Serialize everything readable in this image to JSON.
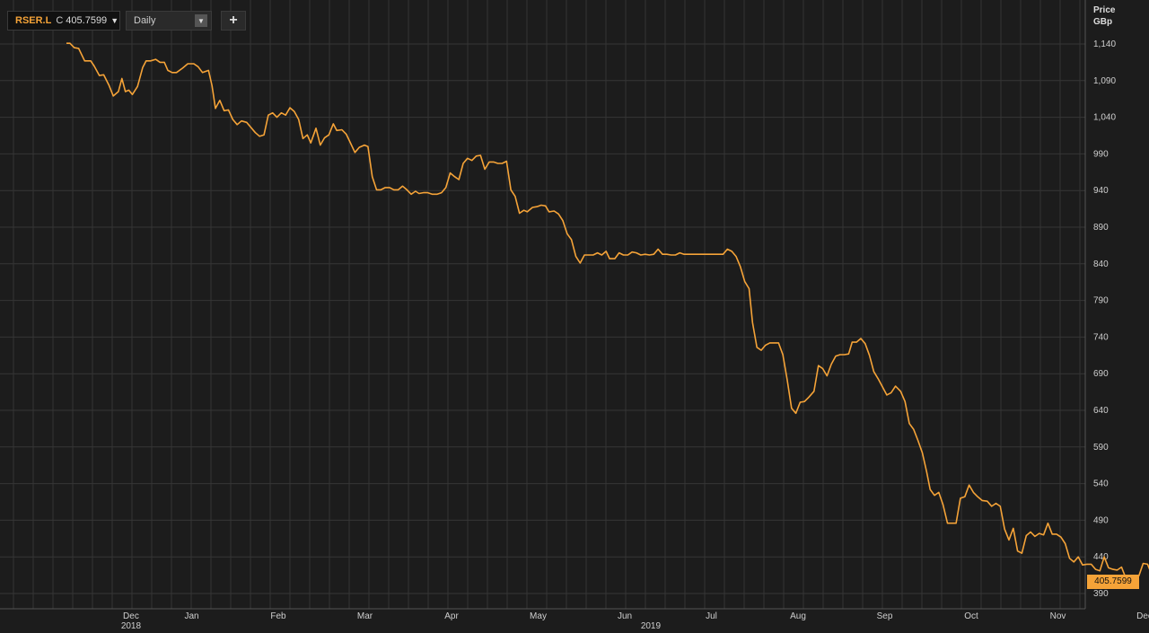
{
  "toolbar": {
    "symbol": "RSER.L",
    "close_tag": "C",
    "close_value": "405.7599",
    "interval": "Daily",
    "add_label": "+"
  },
  "axis": {
    "price_label": "Price",
    "currency_label": "GBp"
  },
  "last_price_label": "405.7599",
  "colors": {
    "line": "#f5a338",
    "background": "#1c1c1c",
    "grid": "#3a3a3a"
  },
  "chart_data": {
    "type": "line",
    "title": "",
    "xlabel": "",
    "ylabel": "Price GBp",
    "ylim": [
      380,
      1150
    ],
    "y_ticks": [
      390,
      440,
      490,
      540,
      590,
      640,
      690,
      740,
      790,
      840,
      890,
      940,
      990,
      1040,
      1090,
      1140
    ],
    "x_months": [
      {
        "label": "Dec",
        "year": "2018",
        "x": 0.3
      },
      {
        "label": "Jan",
        "x": 1.0
      },
      {
        "label": "Feb",
        "x": 2.0
      },
      {
        "label": "Mar",
        "x": 3.0
      },
      {
        "label": "Apr",
        "x": 4.0
      },
      {
        "label": "May",
        "x": 5.0
      },
      {
        "label": "Jun",
        "x": 6.0
      },
      {
        "label": "Jul",
        "x": 7.0
      },
      {
        "label": "Aug",
        "x": 8.0
      },
      {
        "label": "Sep",
        "x": 9.0
      },
      {
        "label": "Oct",
        "x": 10.0
      },
      {
        "label": "Nov",
        "x": 11.0
      },
      {
        "label": "Dec",
        "x": 12.0
      }
    ],
    "year_label": {
      "label": "2019",
      "x": 6.3
    },
    "x_range": [
      -0.3,
      11.8
    ],
    "series": [
      {
        "name": "RSER.L",
        "points": [
          [
            -0.3,
            1141
          ],
          [
            -0.26,
            1141
          ],
          [
            -0.21,
            1135
          ],
          [
            -0.16,
            1134
          ],
          [
            -0.09,
            1117
          ],
          [
            -0.02,
            1117
          ],
          [
            0.02,
            1110
          ],
          [
            0.08,
            1097
          ],
          [
            0.13,
            1098
          ],
          [
            0.19,
            1084
          ],
          [
            0.24,
            1069
          ],
          [
            0.3,
            1075
          ],
          [
            0.34,
            1093
          ],
          [
            0.38,
            1075
          ],
          [
            0.42,
            1077
          ],
          [
            0.46,
            1071
          ],
          [
            0.52,
            1082
          ],
          [
            0.58,
            1108
          ],
          [
            0.62,
            1117
          ],
          [
            0.67,
            1117
          ],
          [
            0.73,
            1119
          ],
          [
            0.78,
            1115
          ],
          [
            0.83,
            1115
          ],
          [
            0.87,
            1104
          ],
          [
            0.92,
            1101
          ],
          [
            0.97,
            1101
          ],
          [
            1.04,
            1107
          ],
          [
            1.1,
            1113
          ],
          [
            1.17,
            1113
          ],
          [
            1.22,
            1109
          ],
          [
            1.27,
            1101
          ],
          [
            1.34,
            1104
          ],
          [
            1.38,
            1083
          ],
          [
            1.42,
            1052
          ],
          [
            1.47,
            1063
          ],
          [
            1.52,
            1049
          ],
          [
            1.57,
            1050
          ],
          [
            1.62,
            1037
          ],
          [
            1.67,
            1030
          ],
          [
            1.72,
            1035
          ],
          [
            1.78,
            1033
          ],
          [
            1.83,
            1026
          ],
          [
            1.88,
            1019
          ],
          [
            1.93,
            1014
          ],
          [
            1.98,
            1016
          ],
          [
            2.03,
            1043
          ],
          [
            2.08,
            1046
          ],
          [
            2.13,
            1040
          ],
          [
            2.18,
            1046
          ],
          [
            2.23,
            1043
          ],
          [
            2.28,
            1053
          ],
          [
            2.33,
            1048
          ],
          [
            2.38,
            1037
          ],
          [
            2.43,
            1011
          ],
          [
            2.48,
            1016
          ],
          [
            2.52,
            1005
          ],
          [
            2.58,
            1025
          ],
          [
            2.63,
            1002
          ],
          [
            2.68,
            1012
          ],
          [
            2.73,
            1016
          ],
          [
            2.78,
            1031
          ],
          [
            2.82,
            1022
          ],
          [
            2.88,
            1023
          ],
          [
            2.93,
            1017
          ],
          [
            2.97,
            1007
          ],
          [
            3.03,
            992
          ],
          [
            3.08,
            999
          ],
          [
            3.14,
            1002
          ],
          [
            3.18,
            1000
          ],
          [
            3.23,
            959
          ],
          [
            3.28,
            941
          ],
          [
            3.33,
            941
          ],
          [
            3.38,
            944
          ],
          [
            3.43,
            944
          ],
          [
            3.48,
            941
          ],
          [
            3.53,
            941
          ],
          [
            3.58,
            946
          ],
          [
            3.63,
            941
          ],
          [
            3.68,
            935
          ],
          [
            3.73,
            939
          ],
          [
            3.77,
            936
          ],
          [
            3.82,
            937
          ],
          [
            3.87,
            937
          ],
          [
            3.92,
            935
          ],
          [
            3.98,
            935
          ],
          [
            4.03,
            937
          ],
          [
            4.08,
            944
          ],
          [
            4.13,
            964
          ],
          [
            4.18,
            959
          ],
          [
            4.23,
            955
          ],
          [
            4.28,
            977
          ],
          [
            4.33,
            984
          ],
          [
            4.38,
            981
          ],
          [
            4.43,
            987
          ],
          [
            4.48,
            988
          ],
          [
            4.53,
            969
          ],
          [
            4.58,
            979
          ],
          [
            4.63,
            979
          ],
          [
            4.68,
            977
          ],
          [
            4.73,
            977
          ],
          [
            4.78,
            980
          ],
          [
            4.83,
            941
          ],
          [
            4.88,
            932
          ],
          [
            4.93,
            909
          ],
          [
            4.98,
            913
          ],
          [
            5.02,
            911
          ],
          [
            5.08,
            917
          ],
          [
            5.13,
            918
          ],
          [
            5.18,
            920
          ],
          [
            5.23,
            919
          ],
          [
            5.27,
            911
          ],
          [
            5.33,
            912
          ],
          [
            5.38,
            908
          ],
          [
            5.43,
            899
          ],
          [
            5.48,
            881
          ],
          [
            5.53,
            873
          ],
          [
            5.58,
            850
          ],
          [
            5.63,
            841
          ],
          [
            5.68,
            852
          ],
          [
            5.73,
            852
          ],
          [
            5.78,
            852
          ],
          [
            5.83,
            855
          ],
          [
            5.88,
            852
          ],
          [
            5.93,
            857
          ],
          [
            5.97,
            847
          ],
          [
            6.03,
            847
          ],
          [
            6.08,
            855
          ],
          [
            6.13,
            852
          ],
          [
            6.18,
            852
          ],
          [
            6.23,
            856
          ],
          [
            6.28,
            855
          ],
          [
            6.33,
            852
          ],
          [
            6.38,
            853
          ],
          [
            6.43,
            852
          ],
          [
            6.48,
            853
          ],
          [
            6.53,
            860
          ],
          [
            6.58,
            853
          ],
          [
            6.63,
            853
          ],
          [
            6.68,
            852
          ],
          [
            6.73,
            852
          ],
          [
            6.78,
            855
          ],
          [
            6.83,
            853
          ],
          [
            6.88,
            853
          ],
          [
            6.93,
            853
          ],
          [
            6.98,
            853
          ],
          [
            7.03,
            853
          ],
          [
            7.08,
            853
          ],
          [
            7.13,
            853
          ],
          [
            7.18,
            853
          ],
          [
            7.23,
            853
          ],
          [
            7.28,
            853
          ],
          [
            7.33,
            860
          ],
          [
            7.38,
            857
          ],
          [
            7.43,
            850
          ],
          [
            7.48,
            836
          ],
          [
            7.53,
            816
          ],
          [
            7.58,
            806
          ],
          [
            7.62,
            760
          ],
          [
            7.67,
            726
          ],
          [
            7.72,
            722
          ],
          [
            7.77,
            729
          ],
          [
            7.82,
            732
          ],
          [
            7.87,
            732
          ],
          [
            7.92,
            732
          ],
          [
            7.97,
            716
          ],
          [
            8.02,
            682
          ],
          [
            8.07,
            643
          ],
          [
            8.12,
            636
          ],
          [
            8.17,
            651
          ],
          [
            8.22,
            652
          ],
          [
            8.27,
            658
          ],
          [
            8.33,
            666
          ],
          [
            8.38,
            701
          ],
          [
            8.43,
            697
          ],
          [
            8.48,
            687
          ],
          [
            8.53,
            703
          ],
          [
            8.58,
            714
          ],
          [
            8.63,
            716
          ],
          [
            8.68,
            716
          ],
          [
            8.73,
            717
          ],
          [
            8.77,
            733
          ],
          [
            8.82,
            733
          ],
          [
            8.87,
            738
          ],
          [
            8.92,
            731
          ],
          [
            8.97,
            715
          ],
          [
            9.02,
            693
          ],
          [
            9.07,
            683
          ],
          [
            9.12,
            672
          ],
          [
            9.17,
            661
          ],
          [
            9.22,
            664
          ],
          [
            9.27,
            673
          ],
          [
            9.33,
            666
          ],
          [
            9.38,
            652
          ],
          [
            9.43,
            622
          ],
          [
            9.48,
            614
          ],
          [
            9.53,
            599
          ],
          [
            9.58,
            582
          ],
          [
            9.63,
            556
          ],
          [
            9.67,
            532
          ],
          [
            9.72,
            524
          ],
          [
            9.77,
            528
          ],
          [
            9.82,
            511
          ],
          [
            9.87,
            486
          ],
          [
            9.92,
            486
          ],
          [
            9.97,
            486
          ],
          [
            10.02,
            520
          ],
          [
            10.07,
            522
          ],
          [
            10.12,
            538
          ],
          [
            10.17,
            528
          ],
          [
            10.22,
            522
          ],
          [
            10.27,
            517
          ],
          [
            10.33,
            516
          ],
          [
            10.38,
            509
          ],
          [
            10.43,
            513
          ],
          [
            10.48,
            509
          ],
          [
            10.53,
            478
          ],
          [
            10.58,
            463
          ],
          [
            10.63,
            479
          ],
          [
            10.68,
            448
          ],
          [
            10.73,
            445
          ],
          [
            10.78,
            469
          ],
          [
            10.83,
            474
          ],
          [
            10.88,
            468
          ],
          [
            10.93,
            472
          ],
          [
            10.98,
            470
          ],
          [
            11.03,
            486
          ],
          [
            11.08,
            471
          ],
          [
            11.13,
            471
          ],
          [
            11.18,
            467
          ],
          [
            11.23,
            458
          ],
          [
            11.28,
            438
          ],
          [
            11.33,
            433
          ],
          [
            11.38,
            440
          ],
          [
            11.43,
            429
          ],
          [
            11.48,
            430
          ],
          [
            11.53,
            430
          ],
          [
            11.58,
            423
          ],
          [
            11.63,
            421
          ],
          [
            11.68,
            440
          ],
          [
            11.73,
            425
          ],
          [
            11.78,
            423
          ],
          [
            11.83,
            422
          ],
          [
            11.88,
            426
          ],
          [
            11.93,
            411
          ],
          [
            11.98,
            413
          ],
          [
            12.02,
            409
          ],
          [
            12.08,
            414
          ],
          [
            12.13,
            431
          ],
          [
            12.18,
            430
          ],
          [
            12.23,
            415
          ],
          [
            12.28,
            406
          ]
        ]
      }
    ]
  }
}
